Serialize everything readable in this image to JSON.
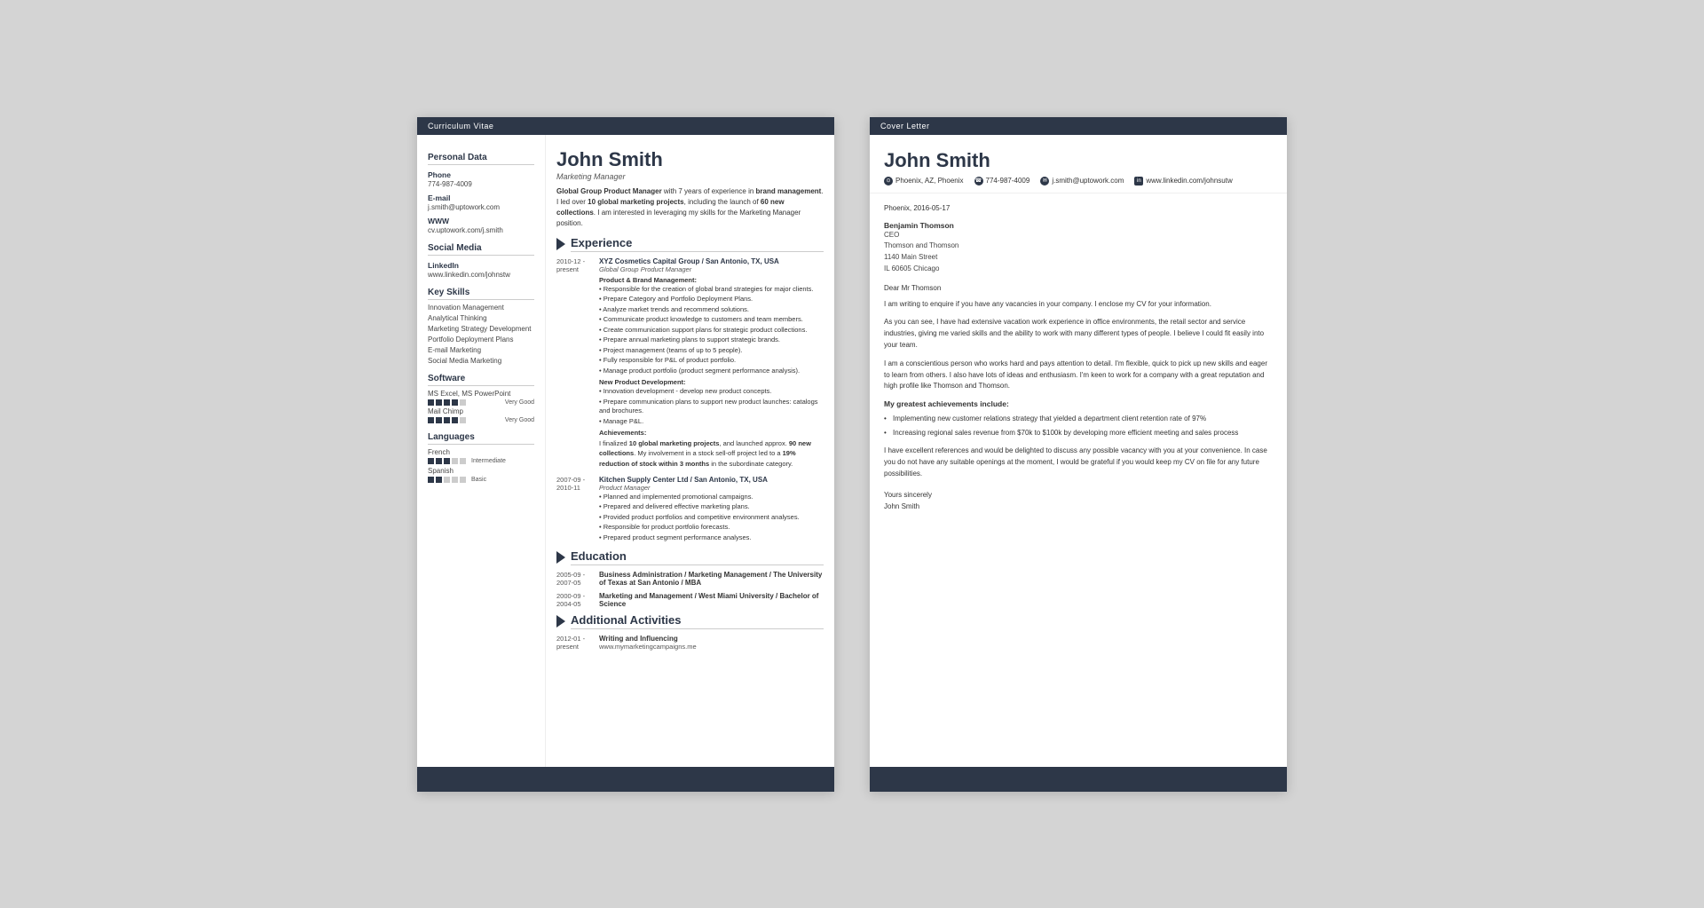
{
  "cv": {
    "header_bar": "Curriculum Vitae",
    "name": "John Smith",
    "job_title": "Marketing Manager",
    "intro": "Global Group Product Manager with 7 years of experience in brand management. I led over 10 global marketing projects, including the launch of 60 new collections. I am interested in leveraging my skills for the Marketing Manager position.",
    "personal_data": {
      "title": "Personal Data",
      "phone_label": "Phone",
      "phone": "774-987-4009",
      "email_label": "E-mail",
      "email": "j.smith@uptowork.com",
      "www_label": "WWW",
      "www": "cv.uptowork.com/j.smith"
    },
    "social_media": {
      "title": "Social Media",
      "linkedin_label": "LinkedIn",
      "linkedin": "www.linkedin.com/johnstw"
    },
    "key_skills": {
      "title": "Key Skills",
      "skills": [
        "Innovation Management",
        "Analytical Thinking",
        "Marketing Strategy Development",
        "Portfolio Deployment Plans",
        "E-mail Marketing",
        "Social Media Marketing"
      ]
    },
    "software": {
      "title": "Software",
      "items": [
        {
          "name": "MS Excel, MS PowerPoint",
          "dots": 4,
          "total": 5,
          "level": "Very Good"
        },
        {
          "name": "Mail Chimp",
          "dots": 4,
          "total": 5,
          "level": "Very Good"
        }
      ]
    },
    "languages": {
      "title": "Languages",
      "items": [
        {
          "name": "French",
          "dots": 3,
          "total": 5,
          "level": "Intermediate"
        },
        {
          "name": "Spanish",
          "dots": 2,
          "total": 5,
          "level": "Basic"
        }
      ]
    },
    "experience": {
      "section_title": "Experience",
      "items": [
        {
          "date": "2010-12 - present",
          "company": "XYZ Cosmetics Capital Group / San Antonio, TX, USA",
          "role": "Global Group Product Manager",
          "subsections": [
            {
              "title": "Product & Brand Management:",
              "bullets": [
                "Responsible for the creation of global brand strategies for major clients.",
                "Prepare Category and Portfolio Deployment Plans.",
                "Analyze market trends and recommend solutions.",
                "Communicate product knowledge to customers and team members.",
                "Create communication support plans for strategic product collections.",
                "Prepare annual marketing plans to support strategic brands.",
                "Project management (teams of up to 5 people).",
                "Fully responsible for P&L of product portfolio.",
                "Manage product portfolio (product segment performance analysis)."
              ]
            },
            {
              "title": "New Product Development:",
              "bullets": [
                "Innovation development - develop new product concepts.",
                "Prepare communication plans to support new product launches: catalogs and brochures.",
                "Manage P&L."
              ]
            },
            {
              "title": "Achievements:",
              "achievement": "I finalized 10 global marketing projects, and launched approx. 90 new collections. My involvement in a stock sell-off project led to a 19% reduction of stock within 3 months in the subordinate category."
            }
          ]
        },
        {
          "date": "2007-09 - 2010-11",
          "company": "Kitchen Supply Center Ltd / San Antonio, TX, USA",
          "role": "Product Manager",
          "bullets": [
            "Planned and implemented promotional campaigns.",
            "Prepared and delivered effective marketing plans.",
            "Provided product portfolios and competitive environment analyses.",
            "Responsible for product portfolio forecasts.",
            "Prepared product segment performance analyses."
          ]
        }
      ]
    },
    "education": {
      "section_title": "Education",
      "items": [
        {
          "date": "2005-09 - 2007-05",
          "degree": "Business Administration / Marketing Management / The University of Texas at San Antonio / MBA"
        },
        {
          "date": "2000-09 - 2004-05",
          "degree": "Marketing and Management / West Miami University / Bachelor of Science"
        }
      ]
    },
    "additional": {
      "section_title": "Additional Activities",
      "items": [
        {
          "date": "2012-01 - present",
          "title": "Writing and Influencing",
          "detail": "www.mymarketingcampaigns.me"
        }
      ]
    }
  },
  "cover_letter": {
    "header_bar": "Cover Letter",
    "name": "John Smith",
    "contact": {
      "location": "Phoenix, AZ, Phoenix",
      "phone": "774-987-4009",
      "email": "j.smith@uptowork.com",
      "linkedin": "www.linkedin.com/johnsutw"
    },
    "date": "Phoenix, 2016-05-17",
    "recipient": {
      "name": "Benjamin Thomson",
      "title": "CEO",
      "company": "Thomson and Thomson",
      "address1": "1140 Main Street",
      "address2": "IL 60605 Chicago"
    },
    "salutation": "Dear Mr Thomson",
    "paragraphs": [
      "I am writing to enquire if you have any vacancies in your company. I enclose my CV for your information.",
      "As you can see, I have had extensive vacation work experience in office environments, the retail sector and service industries, giving me varied skills and the ability to work with many different types of people. I believe I could fit easily into your team.",
      "I am a conscientious person who works hard and pays attention to detail. I'm flexible, quick to pick up new skills and eager to learn from others. I also have lots of ideas and enthusiasm. I'm keen to work for a company with a great reputation and high profile like Thomson and Thomson."
    ],
    "achievements_title": "My greatest achievements include:",
    "achievements": [
      "Implementing new customer relations strategy that yielded a department client retention rate of 97%",
      "Increasing regional sales revenue from $70k to $100k by developing more efficient meeting and sales process"
    ],
    "closing_paragraph": "I have excellent references and would be delighted to discuss any possible vacancy with you at your convenience. In case you do not have any suitable openings at the moment, I would be grateful if you would keep my CV on file for any future possibilities.",
    "sign_off": "Yours sincerely",
    "signature": "John Smith"
  }
}
